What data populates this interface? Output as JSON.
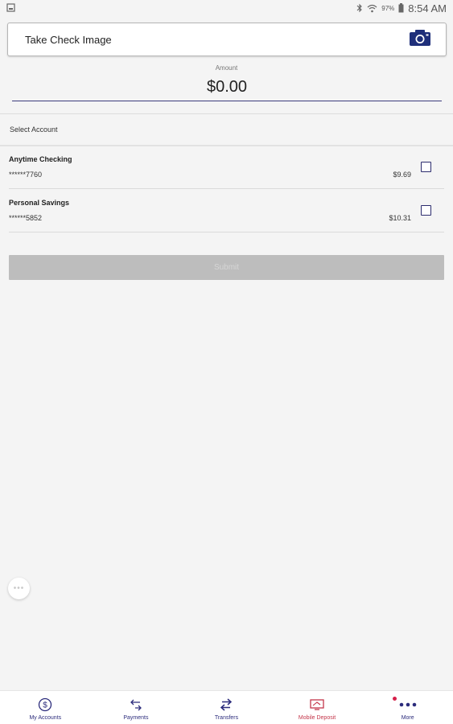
{
  "status_bar": {
    "battery_percent": "97%",
    "time": "8:54 AM"
  },
  "take_check": {
    "label": "Take Check Image",
    "icon": "camera-icon"
  },
  "amount": {
    "label": "Amount",
    "value": "$0.00"
  },
  "select_account": {
    "label": "Select Account"
  },
  "accounts": [
    {
      "name": "Anytime Checking",
      "number": "******7760",
      "balance": "$9.69",
      "selected": false
    },
    {
      "name": "Personal Savings",
      "number": "******5852",
      "balance": "$10.31",
      "selected": false
    }
  ],
  "submit": {
    "label": "Submit",
    "enabled": false
  },
  "floating_more": {
    "label": "•••"
  },
  "bottom_nav": {
    "items": [
      {
        "label": "My Accounts",
        "icon": "dollar-circle-icon",
        "active": false
      },
      {
        "label": "Payments",
        "icon": "payments-icon",
        "active": false
      },
      {
        "label": "Transfers",
        "icon": "transfer-arrows-icon",
        "active": false
      },
      {
        "label": "Mobile Deposit",
        "icon": "check-deposit-icon",
        "active": true
      },
      {
        "label": "More",
        "icon": "more-dots-icon",
        "active": false,
        "notification": true
      }
    ]
  },
  "colors": {
    "primary": "#2c2c7c",
    "active": "#c4364a",
    "background": "#f4f4f4",
    "submit_disabled": "#bdbdbd"
  }
}
